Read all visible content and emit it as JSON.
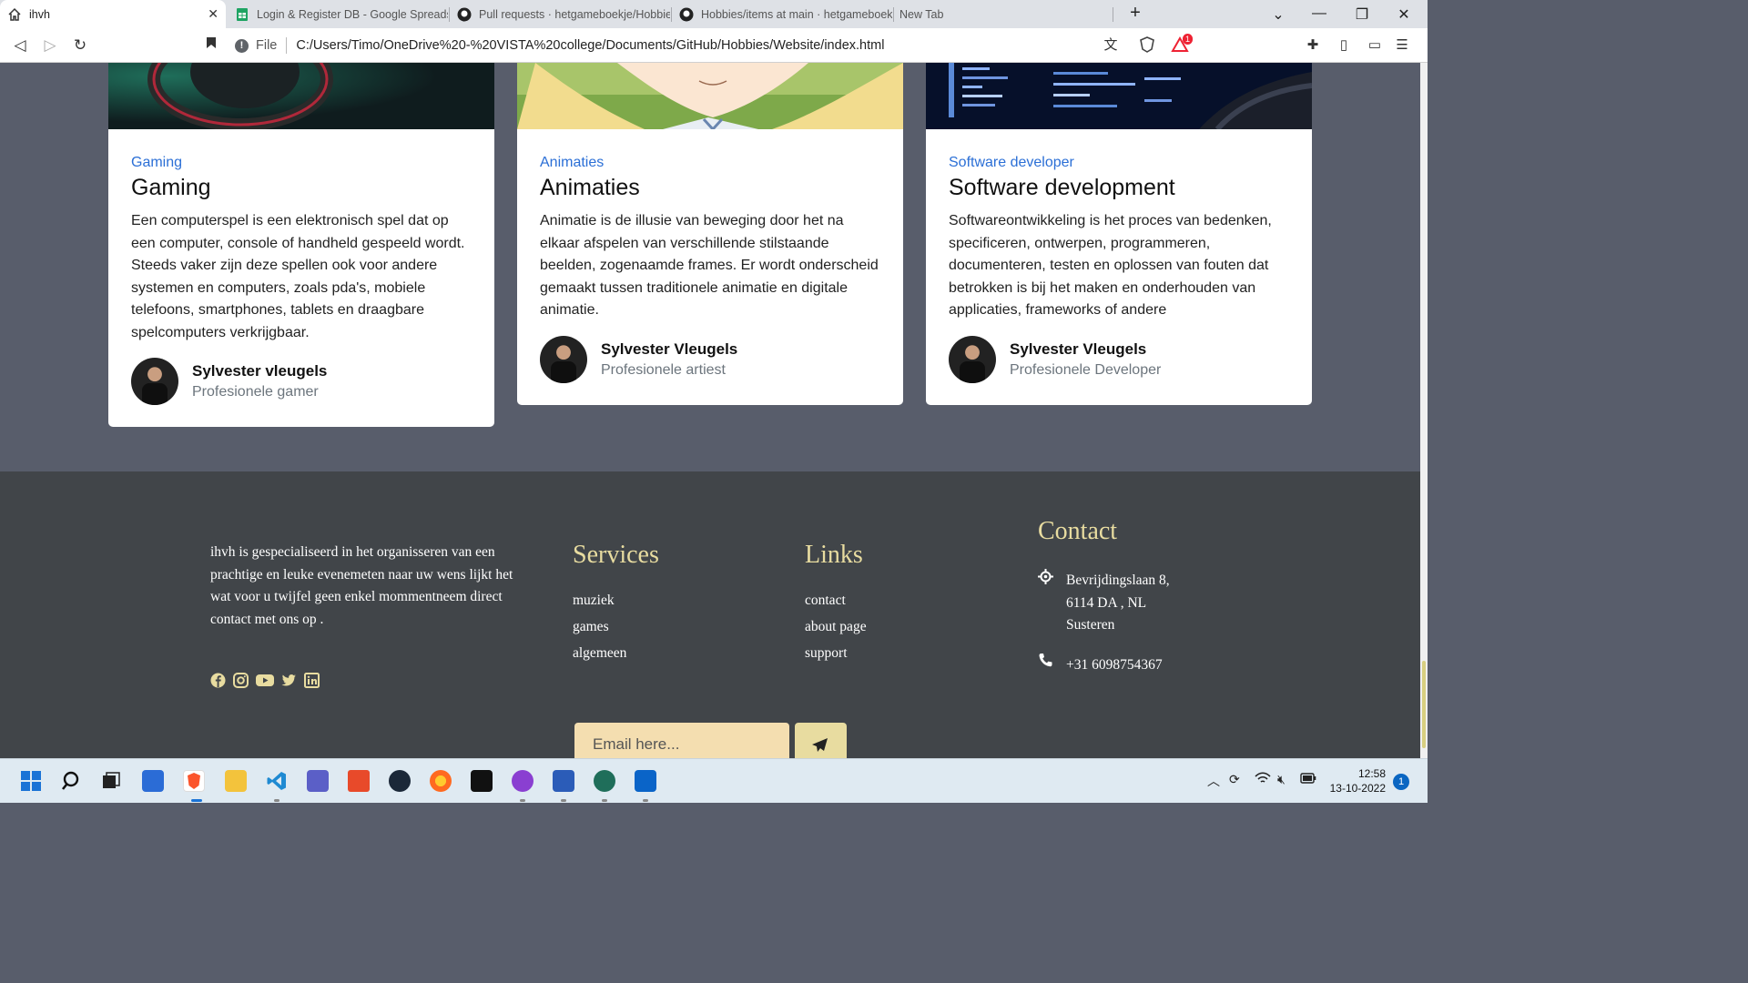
{
  "browser": {
    "tabs": [
      {
        "label": "ihvh",
        "icon": "home-icon",
        "active": true
      },
      {
        "label": "Login & Register DB - Google Spreads",
        "icon": "google-sheets-icon"
      },
      {
        "label": "Pull requests · hetgameboekje/Hobbie",
        "icon": "github-icon"
      },
      {
        "label": "Hobbies/items at main · hetgameboek",
        "icon": "github-icon"
      },
      {
        "label": "New Tab",
        "icon": ""
      }
    ],
    "file_label": "File",
    "url": "C:/Users/Timo/OneDrive%20-%20VISTA%20college/Documents/GitHub/Hobbies/Website/index.html",
    "brave_badge": "1"
  },
  "cards": [
    {
      "category": "Gaming",
      "title": "Gaming",
      "text": "Een computerspel is een elektronisch spel dat op een computer, console of handheld gespeeld wordt. Steeds vaker zijn deze spellen ook voor andere systemen en computers, zoals pda's, mobiele telefoons, smartphones, tablets en draagbare spelcomputers verkrijgbaar.",
      "author": "Sylvester vleugels",
      "role": "Profesionele gamer"
    },
    {
      "category": "Animaties",
      "title": "Animaties",
      "text": "Animatie is de illusie van beweging door het na elkaar afspelen van verschillende stilstaande beelden, zogenaamde frames. Er wordt onderscheid gemaakt tussen traditionele animatie en digitale animatie.",
      "author": "Sylvester Vleugels",
      "role": "Profesionele artiest"
    },
    {
      "category": "Software developer",
      "title": "Software development",
      "text": "Softwareontwikkeling is het proces van bedenken, specificeren, ontwerpen, programmeren, documenteren, testen en oplossen van fouten dat betrokken is bij het maken en onderhouden van applicaties, frameworks of andere",
      "author": "Sylvester Vleugels",
      "role": "Profesionele Developer"
    }
  ],
  "footer": {
    "about": "ihvh is gespecialiseerd in het organisseren van een prachtige en leuke evenemeten naar uw wens lijkt het wat voor u twijfel geen enkel mommentneem direct contact met ons op .",
    "social_icons": [
      "facebook-icon",
      "instagram-icon",
      "youtube-icon",
      "twitter-icon",
      "linkedin-icon"
    ],
    "services_title": "Services",
    "services": [
      "muziek",
      "games",
      "algemeen"
    ],
    "links_title": "Links",
    "links": [
      "contact",
      "about page",
      "support"
    ],
    "contact_title": "Contact",
    "address_line1": "Bevrijdingslaan 8,",
    "address_line2": "6114 DA , NL",
    "address_line3": "Susteren",
    "phone": "+31 6098754367",
    "email_placeholder": "Email here...",
    "accent_color": "#e8dca0"
  },
  "taskbar": {
    "time": "12:58",
    "date": "13-10-2022",
    "notifications": "1"
  }
}
